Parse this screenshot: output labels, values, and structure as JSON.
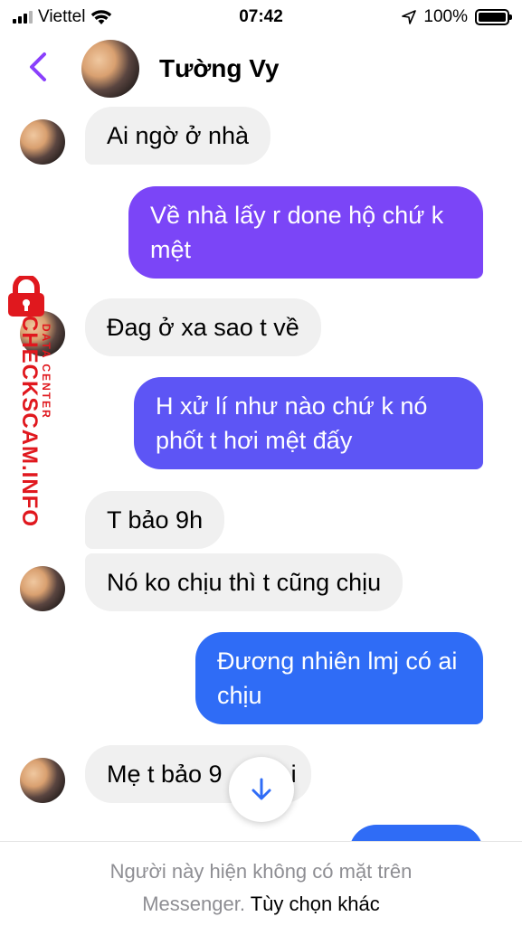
{
  "status_bar": {
    "carrier": "Viettel",
    "time": "07:42",
    "battery": "100%",
    "battery_level": 1.0
  },
  "header": {
    "contact_name": "Tường Vy"
  },
  "messages": [
    {
      "side": "incoming",
      "text": "Ai ngờ ở nhà"
    },
    {
      "side": "outgoing",
      "text": "Về nhà lấy r done hộ chứ k mệt"
    },
    {
      "side": "incoming",
      "text": "Đag ở xa sao t về"
    },
    {
      "side": "outgoing",
      "text": "H xử lí như nào chứ k nó phốt t hơi mệt đấy"
    },
    {
      "side": "incoming",
      "text": "T bảo 9h"
    },
    {
      "side": "incoming",
      "text": "Nó ko chịu thì t cũng chịu"
    },
    {
      "side": "outgoing",
      "text": "Đương nhiên lmj có ai chịu"
    },
    {
      "side": "incoming",
      "text": "Mẹ t bảo 9"
    },
    {
      "side": "incoming",
      "text": "i"
    }
  ],
  "footer": {
    "notice": "Người này hiện không có mặt trên",
    "notice_line2": "Messenger.",
    "link": "Tùy chọn khác"
  },
  "watermark": {
    "main": "CHECKSCAM.INFO",
    "sub": "DATA CENTER"
  },
  "colors": {
    "accent": "#8a3ffc",
    "outgoing_purple": "#7b45f7",
    "outgoing_indigo": "#5d55f5",
    "outgoing_blue": "#2f6cf6",
    "incoming_bg": "#f0f0f0",
    "watermark_red": "#e0181e"
  }
}
